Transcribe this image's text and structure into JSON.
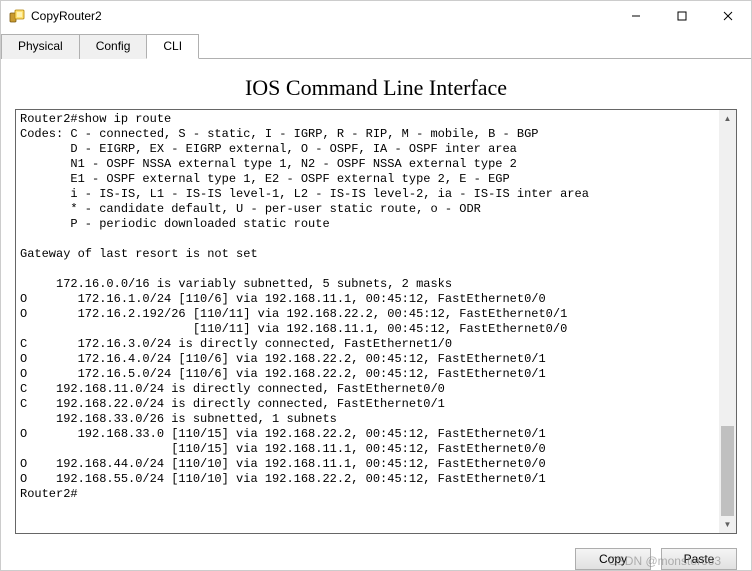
{
  "window": {
    "title": "CopyRouter2"
  },
  "tabs": [
    "Physical",
    "Config",
    "CLI"
  ],
  "active_tab": 2,
  "heading": "IOS Command Line Interface",
  "terminal_lines": [
    "Router2#show ip route",
    "Codes: C - connected, S - static, I - IGRP, R - RIP, M - mobile, B - BGP",
    "       D - EIGRP, EX - EIGRP external, O - OSPF, IA - OSPF inter area",
    "       N1 - OSPF NSSA external type 1, N2 - OSPF NSSA external type 2",
    "       E1 - OSPF external type 1, E2 - OSPF external type 2, E - EGP",
    "       i - IS-IS, L1 - IS-IS level-1, L2 - IS-IS level-2, ia - IS-IS inter area",
    "       * - candidate default, U - per-user static route, o - ODR",
    "       P - periodic downloaded static route",
    "",
    "Gateway of last resort is not set",
    "",
    "     172.16.0.0/16 is variably subnetted, 5 subnets, 2 masks",
    "O       172.16.1.0/24 [110/6] via 192.168.11.1, 00:45:12, FastEthernet0/0",
    "O       172.16.2.192/26 [110/11] via 192.168.22.2, 00:45:12, FastEthernet0/1",
    "                        [110/11] via 192.168.11.1, 00:45:12, FastEthernet0/0",
    "C       172.16.3.0/24 is directly connected, FastEthernet1/0",
    "O       172.16.4.0/24 [110/6] via 192.168.22.2, 00:45:12, FastEthernet0/1",
    "O       172.16.5.0/24 [110/6] via 192.168.22.2, 00:45:12, FastEthernet0/1",
    "C    192.168.11.0/24 is directly connected, FastEthernet0/0",
    "C    192.168.22.0/24 is directly connected, FastEthernet0/1",
    "     192.168.33.0/26 is subnetted, 1 subnets",
    "O       192.168.33.0 [110/15] via 192.168.22.2, 00:45:12, FastEthernet0/1",
    "                     [110/15] via 192.168.11.1, 00:45:12, FastEthernet0/0",
    "O    192.168.44.0/24 [110/10] via 192.168.11.1, 00:45:12, FastEthernet0/0",
    "O    192.168.55.0/24 [110/10] via 192.168.22.2, 00:45:12, FastEthernet0/1",
    "Router2#"
  ],
  "buttons": {
    "copy": "Copy",
    "paste": "Paste"
  },
  "watermark": "CSDN @monster663"
}
